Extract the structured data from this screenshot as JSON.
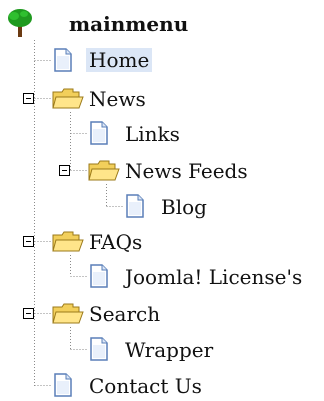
{
  "tree": {
    "root": {
      "label": "mainmenu",
      "icon": "tree-icon"
    },
    "items": [
      {
        "label": "Home",
        "icon": "page-icon",
        "selected": true
      },
      {
        "label": "News",
        "icon": "folder-icon",
        "expanded": true,
        "children": [
          {
            "label": "Links",
            "icon": "page-icon"
          },
          {
            "label": "News Feeds",
            "icon": "folder-icon",
            "expanded": true,
            "children": [
              {
                "label": "Blog",
                "icon": "page-icon"
              }
            ]
          }
        ]
      },
      {
        "label": "FAQs",
        "icon": "folder-icon",
        "expanded": true,
        "children": [
          {
            "label": "Joomla! License's",
            "icon": "page-icon"
          }
        ]
      },
      {
        "label": "Search",
        "icon": "folder-icon",
        "expanded": true,
        "children": [
          {
            "label": "Wrapper",
            "icon": "page-icon"
          }
        ]
      },
      {
        "label": "Contact Us",
        "icon": "page-icon"
      }
    ]
  },
  "colors": {
    "selected_bg": "#dbe6f6",
    "folder": "#f2cf5b",
    "page_border": "#5a7fb8"
  }
}
